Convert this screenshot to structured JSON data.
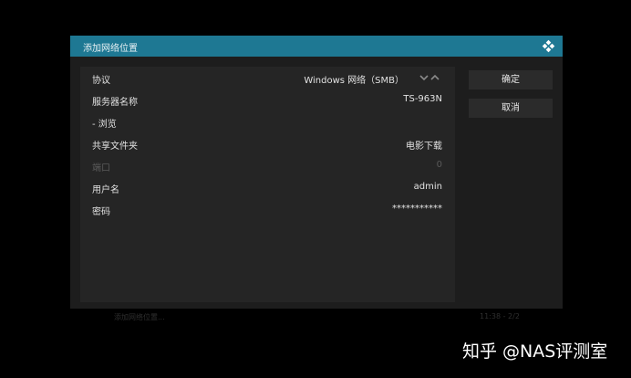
{
  "dialog": {
    "title": "添加网络位置",
    "logo_icon": "kodi-logo-icon"
  },
  "settings": [
    {
      "label": "协议",
      "value": "Windows 网络（SMB）",
      "disabled": false,
      "spinner_icon": "up-down-chevron-icon"
    },
    {
      "label": "服务器名称",
      "value": "TS-963N",
      "disabled": false
    },
    {
      "label": "- 浏览",
      "value": "",
      "disabled": false
    },
    {
      "label": "共享文件夹",
      "value": "电影下载",
      "disabled": false
    },
    {
      "label": "端口",
      "value": "0",
      "disabled": true
    },
    {
      "label": "用户名",
      "value": "admin",
      "disabled": false
    },
    {
      "label": "密码",
      "value": "***********",
      "disabled": false
    }
  ],
  "buttons": {
    "ok_label": "确定",
    "cancel_label": "取消"
  },
  "footer": {
    "left_text": "添加网络位置...",
    "right_text": "11:38 - 2/2"
  },
  "watermark": "知乎 @NAS评测室",
  "colors": {
    "title_bar": "#1e7893",
    "dialog_bg": "#1d1d1d",
    "panel_bg": "#252525",
    "button_bg": "#2b2b2b"
  }
}
